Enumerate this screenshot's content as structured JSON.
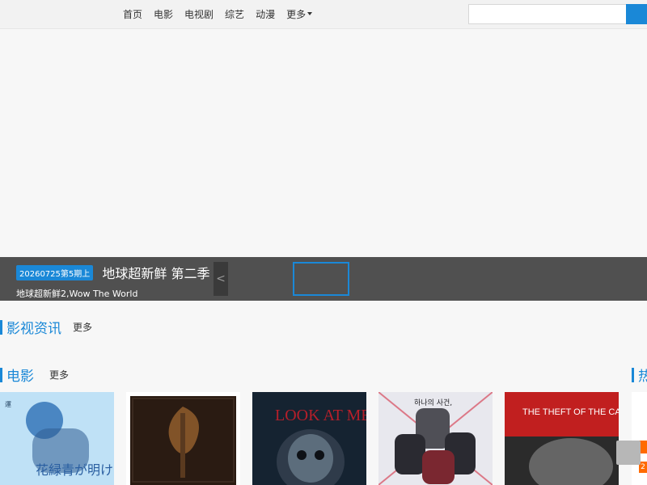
{
  "nav": {
    "items": [
      {
        "label": "首页"
      },
      {
        "label": "电影"
      },
      {
        "label": "电视剧"
      },
      {
        "label": "综艺"
      },
      {
        "label": "动漫"
      }
    ],
    "more_label": "更多"
  },
  "search": {
    "placeholder": ""
  },
  "hero": {
    "badge": "20260725第5期上",
    "title": "地球超新鲜 第二季",
    "subtitle": "地球超新鲜2,Wow The World",
    "prev_label": "<"
  },
  "sections": {
    "news": {
      "title": "影视资讯",
      "more": "更多"
    },
    "movies": {
      "title": "电影",
      "more": "更多"
    },
    "hot": {
      "title": "热"
    }
  },
  "posters": [
    {
      "title": "花緑青が明ける日に",
      "accent": "#5aa6d6"
    },
    {
      "title": "",
      "accent": "#8b5a2b"
    },
    {
      "title": "LOOK AT ME",
      "accent": "#2f3b4a"
    },
    {
      "title": "",
      "accent": "#b8b8b8"
    },
    {
      "title": "THE THEFT OF THE CARAVAGGIO",
      "accent": "#c11f1f"
    }
  ],
  "right_edge": {
    "rank_2": "2"
  }
}
